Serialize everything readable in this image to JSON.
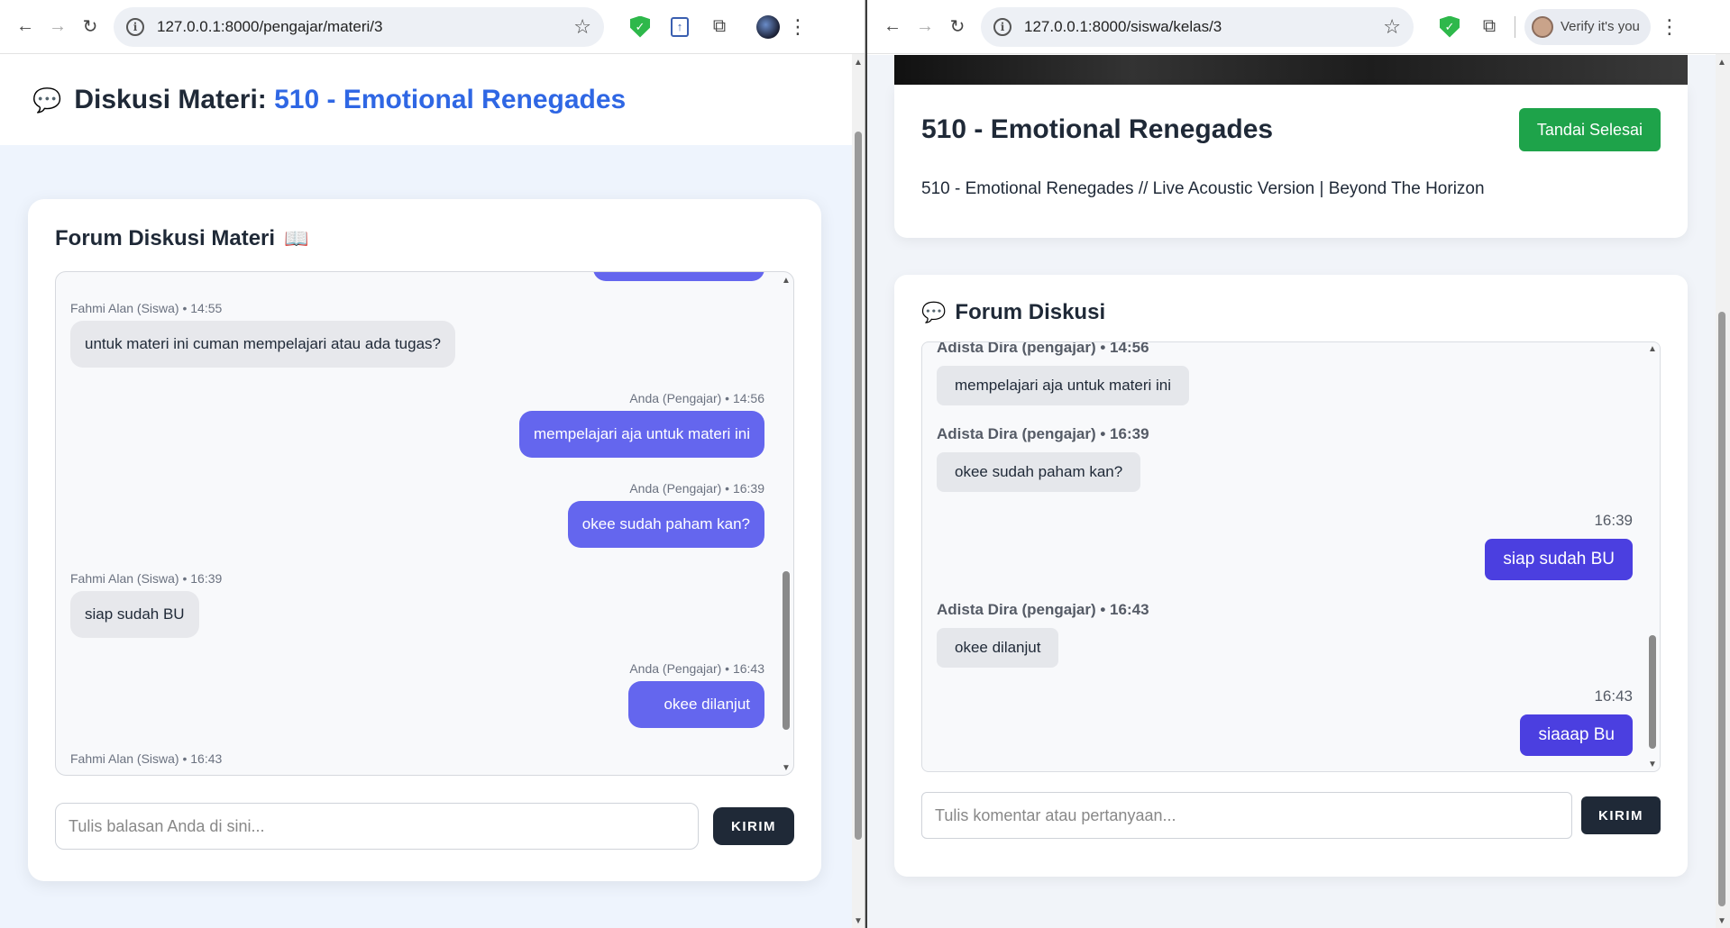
{
  "left": {
    "url": "127.0.0.1:8000/pengajar/materi/3",
    "page_title_prefix": "Diskusi Materi:",
    "page_title_accent": "510 - Emotional Renegades",
    "card_title": "Forum Diskusi Materi",
    "messages": [
      {
        "meta": "Fahmi Alan (Siswa) • 14:55",
        "text": "untuk materi ini cuman mempelajari atau ada tugas?"
      },
      {
        "meta": "Anda (Pengajar) • 14:56",
        "text": "mempelajari aja untuk materi ini"
      },
      {
        "meta": "Anda (Pengajar) • 16:39",
        "text": "okee sudah paham kan?"
      },
      {
        "meta": "Fahmi Alan (Siswa) • 16:39",
        "text": "siap sudah BU"
      },
      {
        "meta": "Anda (Pengajar) • 16:43",
        "text": "okee dilanjut"
      },
      {
        "meta": "Fahmi Alan (Siswa) • 16:43",
        "text": ""
      }
    ],
    "reply_placeholder": "Tulis balasan Anda di sini...",
    "send_label": "KIRIM"
  },
  "right": {
    "url": "127.0.0.1:8000/siswa/kelas/3",
    "verify_label": "Verify it's you",
    "material_title": "510 - Emotional Renegades",
    "done_label": "Tandai Selesai",
    "description": "510 - Emotional Renegades // Live Acoustic Version | Beyond The Horizon",
    "forum_title": "Forum Diskusi",
    "messages": [
      {
        "meta": "Adista Dira (pengajar) • 14:56",
        "text": "mempelajari aja untuk materi ini"
      },
      {
        "meta": "Adista Dira (pengajar) • 16:39",
        "text": "okee sudah paham kan?"
      },
      {
        "meta": "16:39",
        "text": "siap sudah BU"
      },
      {
        "meta": "Adista Dira (pengajar) • 16:43",
        "text": "okee dilanjut"
      },
      {
        "meta": "16:43",
        "text": "siaaap Bu"
      }
    ],
    "input_placeholder": "Tulis komentar atau pertanyaan...",
    "send_label": "KIRIM"
  },
  "colors": {
    "accent_blue": "#2f67e4",
    "outgoing_bubble_left": "#6466ee",
    "outgoing_bubble_right": "#4b3fe0",
    "done_green": "#1ea34a",
    "send_dark": "#1f2937"
  }
}
